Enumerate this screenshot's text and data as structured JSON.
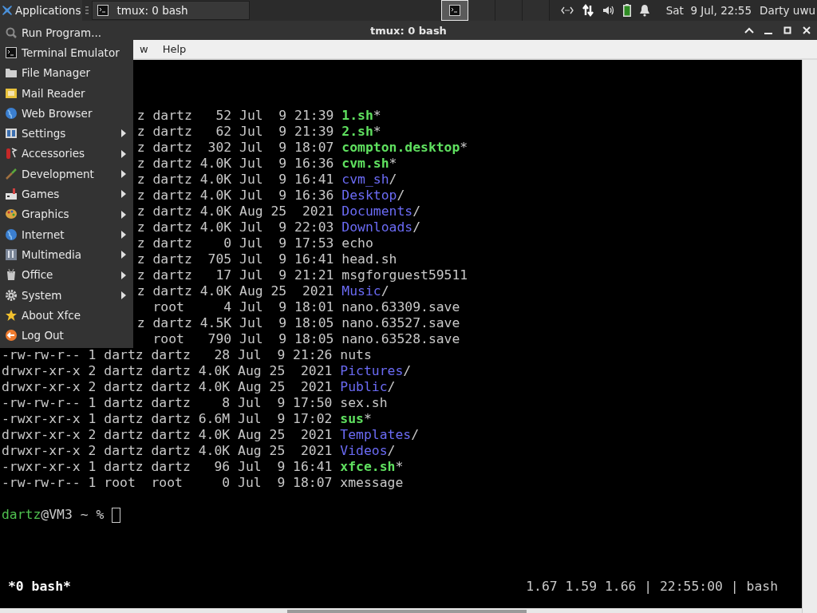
{
  "panel": {
    "applications_label": "Applications",
    "task": {
      "title": "tmux: 0 bash"
    },
    "workspaces": [
      {
        "selected": true
      },
      {
        "selected": false
      },
      {
        "selected": false
      },
      {
        "selected": false
      }
    ],
    "clock": "Sat  9 Jul, 22:55",
    "user": "Darty uwu"
  },
  "window": {
    "title": "tmux: 0 bash",
    "menubar": [
      "w",
      "Help"
    ]
  },
  "app_menu": [
    {
      "label": "Run Program...",
      "has_submenu": false
    },
    {
      "label": "Terminal Emulator",
      "has_submenu": false
    },
    {
      "label": "File Manager",
      "has_submenu": false
    },
    {
      "label": "Mail Reader",
      "has_submenu": false
    },
    {
      "label": "Web Browser",
      "has_submenu": false
    },
    {
      "label": "Settings",
      "has_submenu": true
    },
    {
      "label": "Accessories",
      "has_submenu": true
    },
    {
      "label": "Development",
      "has_submenu": true
    },
    {
      "label": "Games",
      "has_submenu": true
    },
    {
      "label": "Graphics",
      "has_submenu": true
    },
    {
      "label": "Internet",
      "has_submenu": true
    },
    {
      "label": "Multimedia",
      "has_submenu": true
    },
    {
      "label": "Office",
      "has_submenu": true
    },
    {
      "label": "System",
      "has_submenu": true
    },
    {
      "label": "About Xfce",
      "has_submenu": false
    },
    {
      "label": "Log Out",
      "has_submenu": false
    }
  ],
  "terminal": {
    "rows": [
      {
        "partial": true,
        "info": "z dartz   52 Jul  9 21:39 ",
        "name": "1.sh",
        "suffix": "*",
        "kind": "exec"
      },
      {
        "partial": true,
        "info": "z dartz   62 Jul  9 21:39 ",
        "name": "2.sh",
        "suffix": "*",
        "kind": "exec"
      },
      {
        "partial": true,
        "info": "z dartz  302 Jul  9 18:07 ",
        "name": "compton.desktop",
        "suffix": "*",
        "kind": "exec"
      },
      {
        "partial": true,
        "info": "z dartz 4.0K Jul  9 16:36 ",
        "name": "cvm.sh",
        "suffix": "*",
        "kind": "exec"
      },
      {
        "partial": true,
        "info": "z dartz 4.0K Jul  9 16:41 ",
        "name": "cvm_sh",
        "suffix": "/",
        "kind": "dir"
      },
      {
        "partial": true,
        "info": "z dartz 4.0K Jul  9 16:36 ",
        "name": "Desktop",
        "suffix": "/",
        "kind": "dir"
      },
      {
        "partial": true,
        "info": "z dartz 4.0K Aug 25  2021 ",
        "name": "Documents",
        "suffix": "/",
        "kind": "dir"
      },
      {
        "partial": true,
        "info": "z dartz 4.0K Jul  9 22:03 ",
        "name": "Downloads",
        "suffix": "/",
        "kind": "dir"
      },
      {
        "partial": true,
        "info": "z dartz    0 Jul  9 17:53 ",
        "name": "echo",
        "kind": "file"
      },
      {
        "partial": true,
        "info": "z dartz  705 Jul  9 16:41 ",
        "name": "head.sh",
        "kind": "file"
      },
      {
        "partial": true,
        "info": "z dartz   17 Jul  9 21:21 ",
        "name": "msgforguest59511",
        "kind": "file"
      },
      {
        "partial": true,
        "info": "z dartz 4.0K Aug 25  2021 ",
        "name": "Music",
        "suffix": "/",
        "kind": "dir"
      },
      {
        "partial": true,
        "info": "  root     4 Jul  9 18:01 ",
        "name": "nano.63309.save",
        "kind": "file"
      },
      {
        "partial": true,
        "info": "z dartz 4.5K Jul  9 18:05 ",
        "name": "nano.63527.save",
        "kind": "file"
      },
      {
        "partial": true,
        "info": "  root   790 Jul  9 18:05 ",
        "name": "nano.63528.save",
        "kind": "file"
      },
      {
        "partial": false,
        "info": "-rw-rw-r-- 1 dartz dartz   28 Jul  9 21:26 ",
        "name": "nuts",
        "kind": "file"
      },
      {
        "partial": false,
        "info": "drwxr-xr-x 2 dartz dartz 4.0K Aug 25  2021 ",
        "name": "Pictures",
        "suffix": "/",
        "kind": "dir"
      },
      {
        "partial": false,
        "info": "drwxr-xr-x 2 dartz dartz 4.0K Aug 25  2021 ",
        "name": "Public",
        "suffix": "/",
        "kind": "dir"
      },
      {
        "partial": false,
        "info": "-rw-rw-r-- 1 dartz dartz    8 Jul  9 17:50 ",
        "name": "sex.sh",
        "kind": "file"
      },
      {
        "partial": false,
        "info": "-rwxr-xr-x 1 dartz dartz 6.6M Jul  9 17:02 ",
        "name": "sus",
        "suffix": "*",
        "kind": "exec"
      },
      {
        "partial": false,
        "info": "drwxr-xr-x 2 dartz dartz 4.0K Aug 25  2021 ",
        "name": "Templates",
        "suffix": "/",
        "kind": "dir"
      },
      {
        "partial": false,
        "info": "drwxr-xr-x 2 dartz dartz 4.0K Aug 25  2021 ",
        "name": "Videos",
        "suffix": "/",
        "kind": "dir"
      },
      {
        "partial": false,
        "info": "-rwxr-xr-x 1 dartz dartz   96 Jul  9 16:41 ",
        "name": "xfce.sh",
        "suffix": "*",
        "kind": "exec"
      },
      {
        "partial": false,
        "info": "-rw-rw-r-- 1 root  root     0 Jul  9 18:07 ",
        "name": "xmessage",
        "kind": "file"
      }
    ],
    "prompt": {
      "user": "dartz",
      "rest": "@VM3 ~ %"
    },
    "status_left": "*0 bash*",
    "status_right": "1.67 1.59 1.66 | 22:55:00 | bash"
  }
}
